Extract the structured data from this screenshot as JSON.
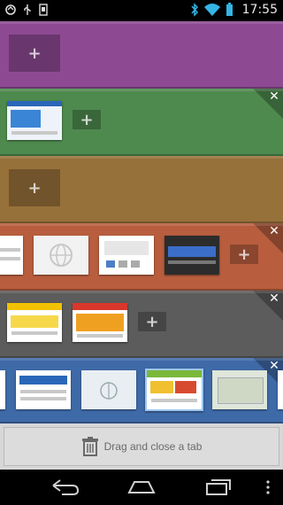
{
  "status_bar": {
    "time": "17:55",
    "left_icons": [
      "app-notification-icon",
      "usb-icon",
      "sd-card-icon"
    ],
    "right_icons": [
      "bluetooth-icon",
      "wifi-icon",
      "battery-icon"
    ]
  },
  "panels": [
    {
      "color": "#8d4a92",
      "tabs": 0,
      "has_close": false
    },
    {
      "color": "#4e8a4e",
      "tabs": 1,
      "has_close": true
    },
    {
      "color": "#97713a",
      "tabs": 0,
      "has_close": false
    },
    {
      "color": "#b85e3e",
      "tabs": 4,
      "has_close": true
    },
    {
      "color": "#5c5c5c",
      "tabs": 2,
      "has_close": true
    },
    {
      "color": "#3f6aa8",
      "tabs": 5,
      "has_close": true
    }
  ],
  "bottom": {
    "drag_label": "Drag and close a tab"
  },
  "nav": {
    "icons": [
      "back-icon",
      "home-icon",
      "recent-apps-icon",
      "menu-icon"
    ]
  }
}
